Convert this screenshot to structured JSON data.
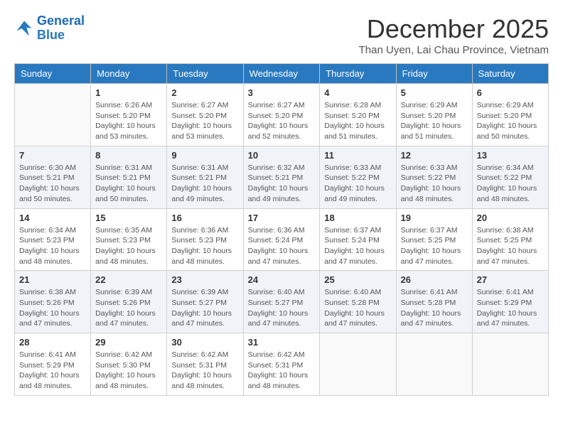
{
  "header": {
    "logo_line1": "General",
    "logo_line2": "Blue",
    "month_title": "December 2025",
    "subtitle": "Than Uyen, Lai Chau Province, Vietnam"
  },
  "weekdays": [
    "Sunday",
    "Monday",
    "Tuesday",
    "Wednesday",
    "Thursday",
    "Friday",
    "Saturday"
  ],
  "weeks": [
    [
      {
        "day": "",
        "info": ""
      },
      {
        "day": "1",
        "info": "Sunrise: 6:26 AM\nSunset: 5:20 PM\nDaylight: 10 hours\nand 53 minutes."
      },
      {
        "day": "2",
        "info": "Sunrise: 6:27 AM\nSunset: 5:20 PM\nDaylight: 10 hours\nand 53 minutes."
      },
      {
        "day": "3",
        "info": "Sunrise: 6:27 AM\nSunset: 5:20 PM\nDaylight: 10 hours\nand 52 minutes."
      },
      {
        "day": "4",
        "info": "Sunrise: 6:28 AM\nSunset: 5:20 PM\nDaylight: 10 hours\nand 51 minutes."
      },
      {
        "day": "5",
        "info": "Sunrise: 6:29 AM\nSunset: 5:20 PM\nDaylight: 10 hours\nand 51 minutes."
      },
      {
        "day": "6",
        "info": "Sunrise: 6:29 AM\nSunset: 5:20 PM\nDaylight: 10 hours\nand 50 minutes."
      }
    ],
    [
      {
        "day": "7",
        "info": "Sunrise: 6:30 AM\nSunset: 5:21 PM\nDaylight: 10 hours\nand 50 minutes."
      },
      {
        "day": "8",
        "info": "Sunrise: 6:31 AM\nSunset: 5:21 PM\nDaylight: 10 hours\nand 50 minutes."
      },
      {
        "day": "9",
        "info": "Sunrise: 6:31 AM\nSunset: 5:21 PM\nDaylight: 10 hours\nand 49 minutes."
      },
      {
        "day": "10",
        "info": "Sunrise: 6:32 AM\nSunset: 5:21 PM\nDaylight: 10 hours\nand 49 minutes."
      },
      {
        "day": "11",
        "info": "Sunrise: 6:33 AM\nSunset: 5:22 PM\nDaylight: 10 hours\nand 49 minutes."
      },
      {
        "day": "12",
        "info": "Sunrise: 6:33 AM\nSunset: 5:22 PM\nDaylight: 10 hours\nand 48 minutes."
      },
      {
        "day": "13",
        "info": "Sunrise: 6:34 AM\nSunset: 5:22 PM\nDaylight: 10 hours\nand 48 minutes."
      }
    ],
    [
      {
        "day": "14",
        "info": "Sunrise: 6:34 AM\nSunset: 5:23 PM\nDaylight: 10 hours\nand 48 minutes."
      },
      {
        "day": "15",
        "info": "Sunrise: 6:35 AM\nSunset: 5:23 PM\nDaylight: 10 hours\nand 48 minutes."
      },
      {
        "day": "16",
        "info": "Sunrise: 6:36 AM\nSunset: 5:23 PM\nDaylight: 10 hours\nand 48 minutes."
      },
      {
        "day": "17",
        "info": "Sunrise: 6:36 AM\nSunset: 5:24 PM\nDaylight: 10 hours\nand 47 minutes."
      },
      {
        "day": "18",
        "info": "Sunrise: 6:37 AM\nSunset: 5:24 PM\nDaylight: 10 hours\nand 47 minutes."
      },
      {
        "day": "19",
        "info": "Sunrise: 6:37 AM\nSunset: 5:25 PM\nDaylight: 10 hours\nand 47 minutes."
      },
      {
        "day": "20",
        "info": "Sunrise: 6:38 AM\nSunset: 5:25 PM\nDaylight: 10 hours\nand 47 minutes."
      }
    ],
    [
      {
        "day": "21",
        "info": "Sunrise: 6:38 AM\nSunset: 5:26 PM\nDaylight: 10 hours\nand 47 minutes."
      },
      {
        "day": "22",
        "info": "Sunrise: 6:39 AM\nSunset: 5:26 PM\nDaylight: 10 hours\nand 47 minutes."
      },
      {
        "day": "23",
        "info": "Sunrise: 6:39 AM\nSunset: 5:27 PM\nDaylight: 10 hours\nand 47 minutes."
      },
      {
        "day": "24",
        "info": "Sunrise: 6:40 AM\nSunset: 5:27 PM\nDaylight: 10 hours\nand 47 minutes."
      },
      {
        "day": "25",
        "info": "Sunrise: 6:40 AM\nSunset: 5:28 PM\nDaylight: 10 hours\nand 47 minutes."
      },
      {
        "day": "26",
        "info": "Sunrise: 6:41 AM\nSunset: 5:28 PM\nDaylight: 10 hours\nand 47 minutes."
      },
      {
        "day": "27",
        "info": "Sunrise: 6:41 AM\nSunset: 5:29 PM\nDaylight: 10 hours\nand 47 minutes."
      }
    ],
    [
      {
        "day": "28",
        "info": "Sunrise: 6:41 AM\nSunset: 5:29 PM\nDaylight: 10 hours\nand 48 minutes."
      },
      {
        "day": "29",
        "info": "Sunrise: 6:42 AM\nSunset: 5:30 PM\nDaylight: 10 hours\nand 48 minutes."
      },
      {
        "day": "30",
        "info": "Sunrise: 6:42 AM\nSunset: 5:31 PM\nDaylight: 10 hours\nand 48 minutes."
      },
      {
        "day": "31",
        "info": "Sunrise: 6:42 AM\nSunset: 5:31 PM\nDaylight: 10 hours\nand 48 minutes."
      },
      {
        "day": "",
        "info": ""
      },
      {
        "day": "",
        "info": ""
      },
      {
        "day": "",
        "info": ""
      }
    ]
  ]
}
